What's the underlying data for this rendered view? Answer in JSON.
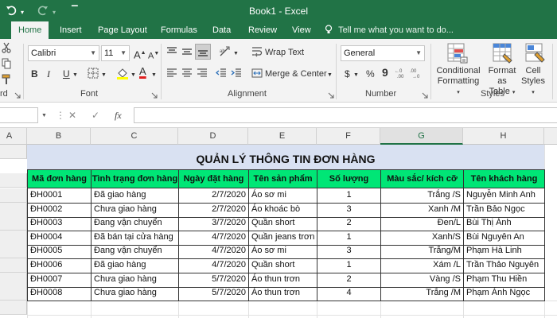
{
  "window": {
    "title": "Book1  -  Excel"
  },
  "quick_access": {
    "save_icon": "save-icon",
    "undo_icon": "undo-icon",
    "redo_icon": "redo-icon"
  },
  "tabs": [
    {
      "label": "Home",
      "active": true
    },
    {
      "label": "Insert"
    },
    {
      "label": "Page Layout"
    },
    {
      "label": "Formulas"
    },
    {
      "label": "Data"
    },
    {
      "label": "Review"
    },
    {
      "label": "View"
    }
  ],
  "tell_me": {
    "placeholder": "Tell me what you want to do..."
  },
  "ribbon": {
    "clipboard_label": "rd",
    "font": {
      "name": "Calibri",
      "size": "11",
      "grow": "A",
      "shrink": "A",
      "bold": "B",
      "italic": "I",
      "underline": "U",
      "font_color": "A",
      "label": "Font"
    },
    "alignment": {
      "wrap_text": "Wrap Text",
      "merge_center": "Merge & Center",
      "label": "Alignment"
    },
    "number": {
      "format": "General",
      "currency": "$",
      "percent": "%",
      "comma": "9",
      "label": "Number"
    },
    "styles": {
      "conditional_formatting": [
        "Conditional",
        "Formatting"
      ],
      "format_as_table": [
        "Format as",
        "Table"
      ],
      "cell_styles": [
        "Cell",
        "Styles"
      ],
      "label": "Styles"
    }
  },
  "formula_bar": {
    "fx": "fx",
    "cancel": "✕",
    "enter": "✓",
    "value": ""
  },
  "columns": [
    "A",
    "B",
    "C",
    "D",
    "E",
    "F",
    "G",
    "H"
  ],
  "selected_column": "G",
  "sheet": {
    "title": "QUẢN LÝ THÔNG TIN ĐƠN HÀNG",
    "headers": [
      "Mã đơn hàng",
      "Tình trạng đơn hàng",
      "Ngày đặt hàng",
      "Tên sản phẩm",
      "Số lượng",
      "Màu sắc/ kích cỡ",
      "Tên khách hàng"
    ],
    "rows": [
      [
        "ĐH0001",
        "Đã giao hàng",
        "2/7/2020",
        "Áo sơ mi",
        "1",
        "Trắng /S",
        "Nguyễn Minh Anh"
      ],
      [
        "ĐH0002",
        "Chưa giao hàng",
        "2/7/2020",
        "Áo khoác bò",
        "3",
        "Xanh /M",
        "Trần Bảo Ngọc"
      ],
      [
        "ĐH0003",
        "Đang vận chuyển",
        "3/7/2020",
        "Quần short",
        "2",
        "Đen/L",
        "Bùi Thị Ánh"
      ],
      [
        "ĐH0004",
        "Đã bán tại cửa hàng",
        "4/7/2020",
        "Quần jeans trơn",
        "1",
        "Xanh/S",
        "Bùi Nguyên An"
      ],
      [
        "ĐH0005",
        "Đang vận chuyển",
        "4/7/2020",
        "Áo sơ mi",
        "3",
        "Trắng/M",
        "Phạm Hà Linh"
      ],
      [
        "ĐH0006",
        "Đã giao hàng",
        "4/7/2020",
        "Quần short",
        "1",
        "Xám /L",
        "Trần Thảo Nguyên"
      ],
      [
        "ĐH0007",
        "Chưa giao hàng",
        "5/7/2020",
        "Áo thun trơn",
        "2",
        "Vàng /S",
        "Phạm Thu Hiền"
      ],
      [
        "ĐH0008",
        "Chưa giao hàng",
        "5/7/2020",
        "Áo thun trơn",
        "4",
        "Trắng /M",
        "Phạm Ánh Ngọc"
      ]
    ]
  },
  "colors": {
    "excel_green": "#217346",
    "header_fill": "#00e676",
    "banner_fill": "#d9e1f2"
  }
}
